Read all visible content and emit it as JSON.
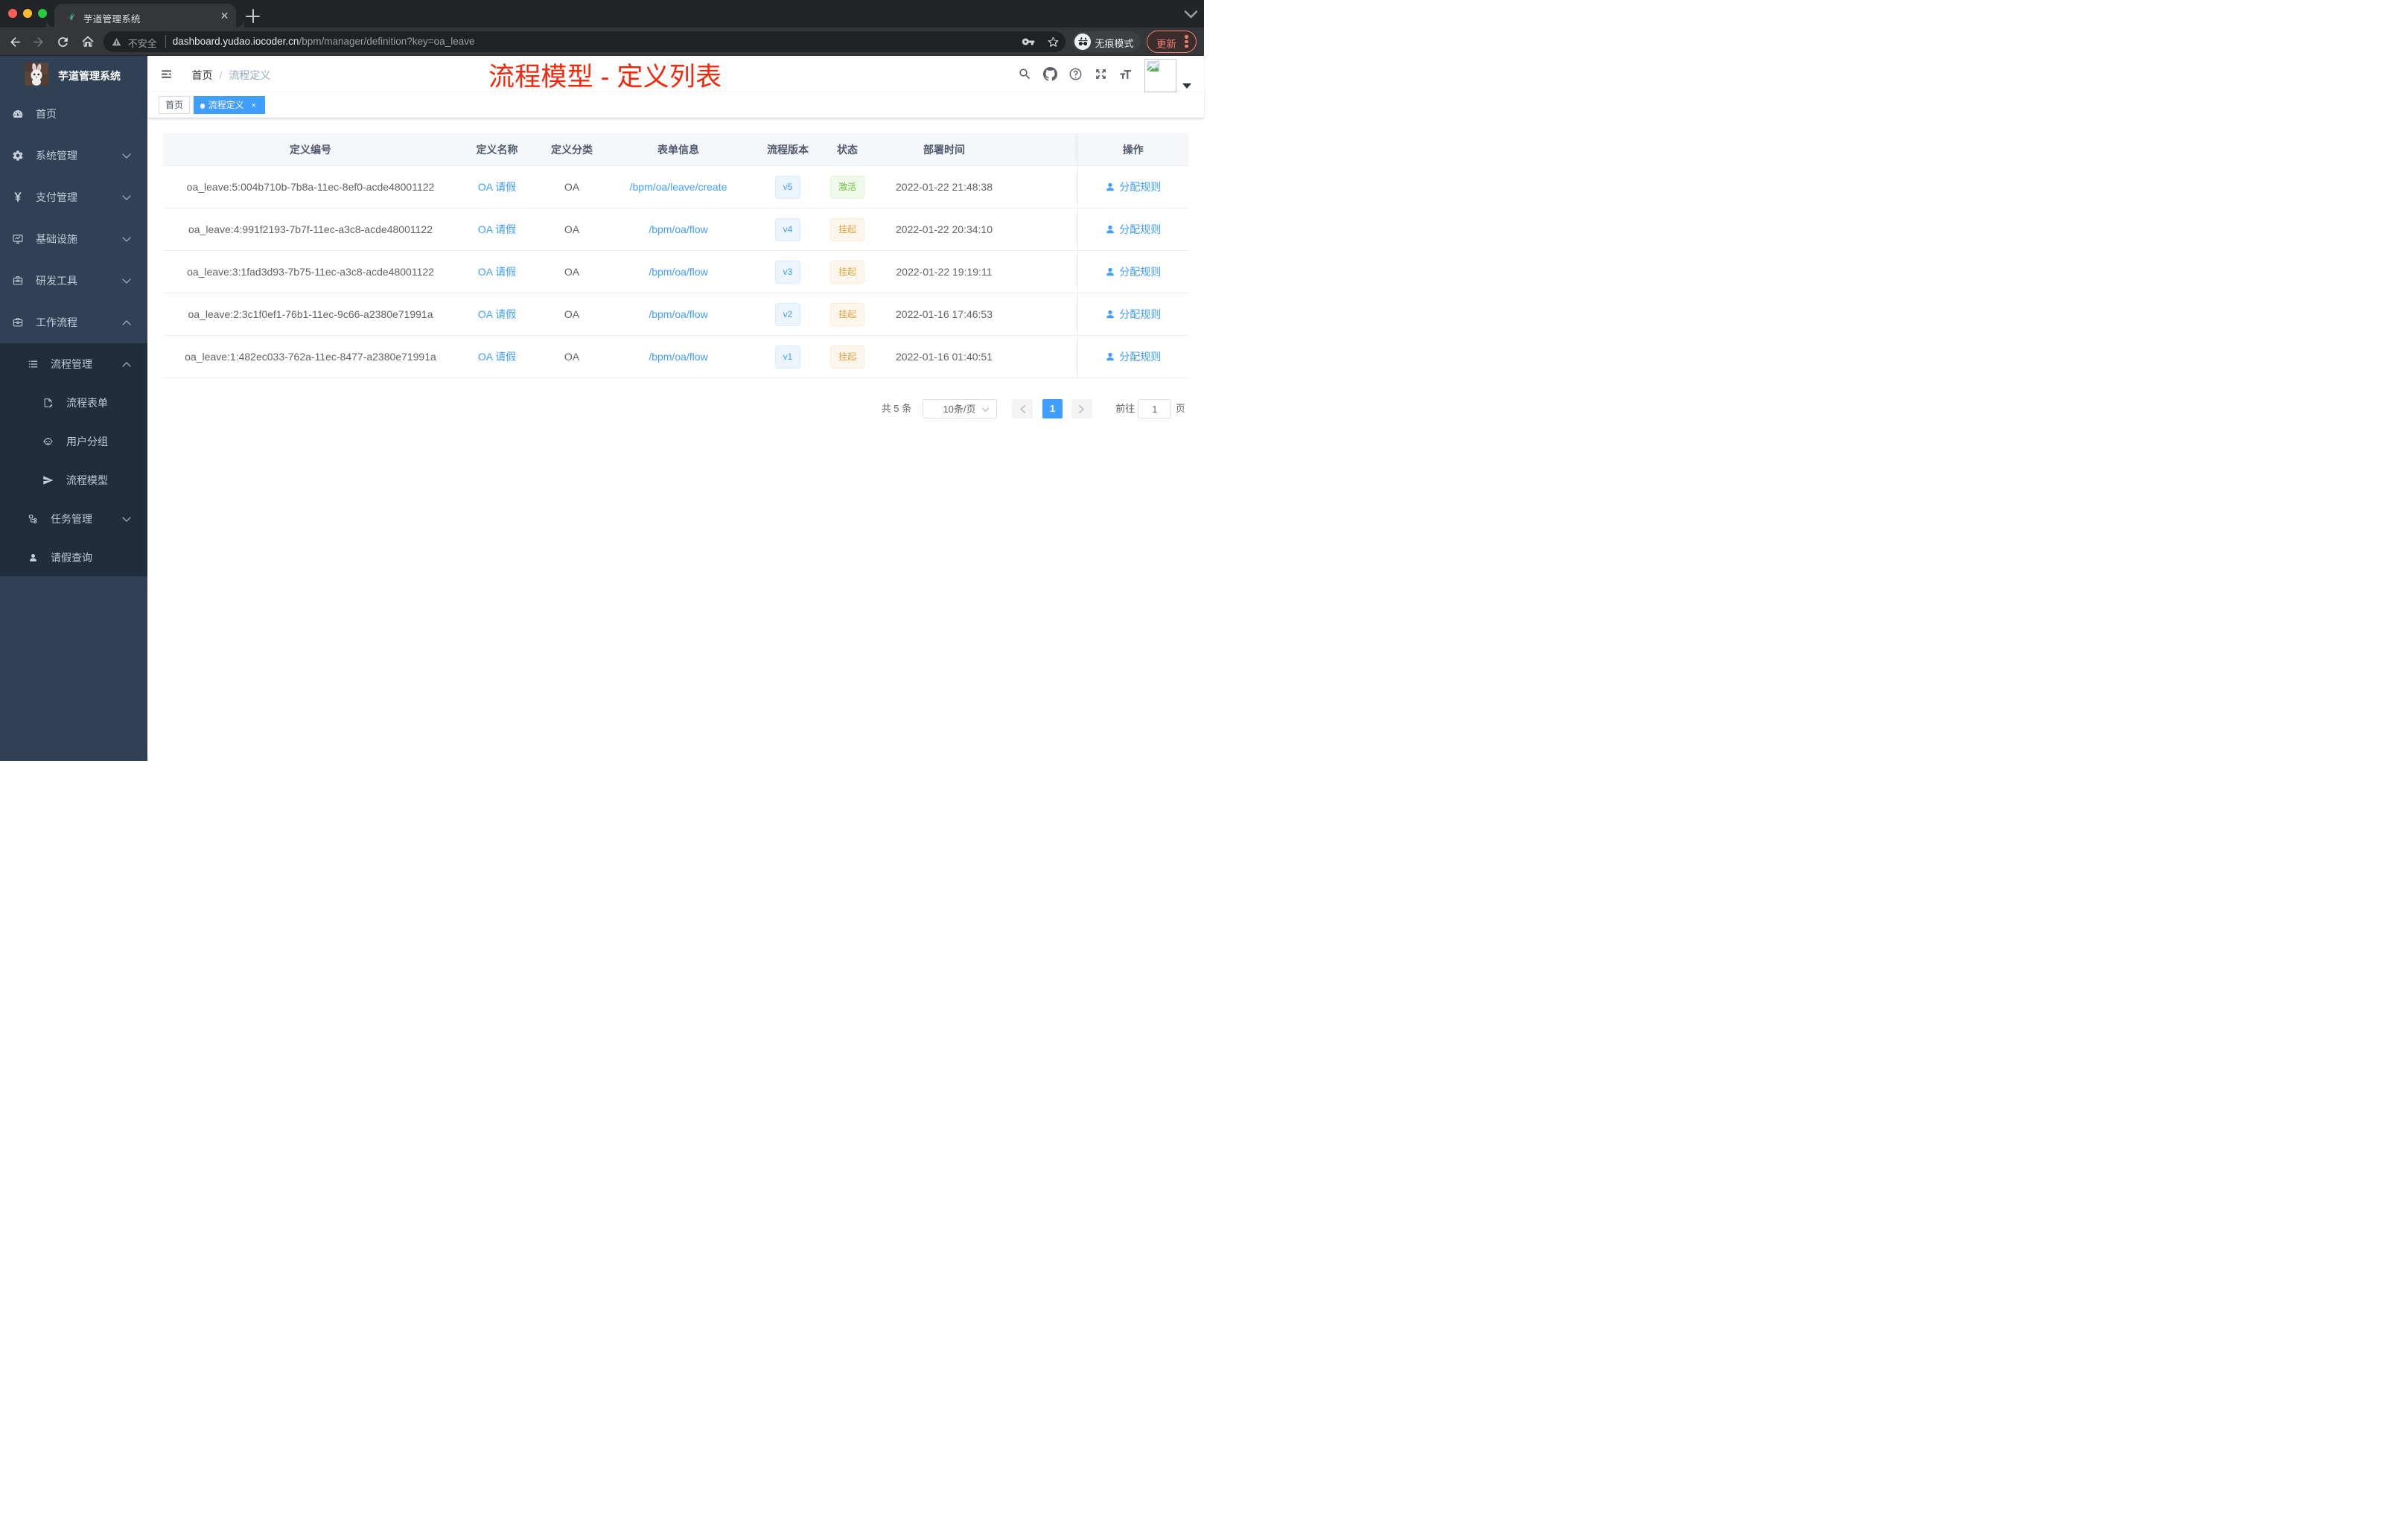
{
  "browser": {
    "tab_title": "芋道管理系统",
    "url_secure_label": "不安全",
    "url_domain": "dashboard.yudao.iocoder.cn",
    "url_path": "/bpm/manager/definition?key=oa_leave",
    "incognito_label": "无痕模式",
    "update_label": "更新"
  },
  "sidebar": {
    "title": "芋道管理系统",
    "items": [
      {
        "label": "首页",
        "icon": "dashboard-icon",
        "level": 0,
        "arrow": ""
      },
      {
        "label": "系统管理",
        "icon": "gear-icon",
        "level": 0,
        "arrow": "down"
      },
      {
        "label": "支付管理",
        "icon": "yen-icon",
        "level": 0,
        "arrow": "down"
      },
      {
        "label": "基础设施",
        "icon": "monitor-icon",
        "level": 0,
        "arrow": "down"
      },
      {
        "label": "研发工具",
        "icon": "briefcase-icon",
        "level": 0,
        "arrow": "down"
      },
      {
        "label": "工作流程",
        "icon": "briefcase-icon",
        "level": 0,
        "arrow": "up"
      }
    ],
    "submenu_items": [
      {
        "label": "流程管理",
        "icon": "list-tree-icon",
        "level": 1,
        "arrow": "up"
      },
      {
        "label": "流程表单",
        "icon": "doc-edit-icon",
        "level": 2,
        "arrow": ""
      },
      {
        "label": "用户分组",
        "icon": "robot-icon",
        "level": 2,
        "arrow": ""
      },
      {
        "label": "流程模型",
        "icon": "send-icon",
        "level": 2,
        "arrow": ""
      },
      {
        "label": "任务管理",
        "icon": "flow-icon",
        "level": 1,
        "arrow": "down"
      },
      {
        "label": "请假查询",
        "icon": "user-icon",
        "level": 1,
        "arrow": ""
      }
    ]
  },
  "navbar": {
    "breadcrumb": {
      "home": "首页",
      "current": "流程定义"
    }
  },
  "tags": [
    {
      "label": "首页",
      "active": false
    },
    {
      "label": "流程定义",
      "active": true
    }
  ],
  "annotation": "流程模型 - 定义列表",
  "table": {
    "headers": [
      "定义编号",
      "定义名称",
      "定义分类",
      "表单信息",
      "流程版本",
      "状态",
      "部署时间",
      "操作"
    ],
    "action_label": "分配规则",
    "rows": [
      {
        "id": "oa_leave:5:004b710b-7b8a-11ec-8ef0-acde48001122",
        "name": "OA 请假",
        "category": "OA",
        "form": "/bpm/oa/leave/create",
        "version": "v5",
        "status": "激活",
        "status_type": "active",
        "time": "2022-01-22 21:48:38"
      },
      {
        "id": "oa_leave:4:991f2193-7b7f-11ec-a3c8-acde48001122",
        "name": "OA 请假",
        "category": "OA",
        "form": "/bpm/oa/flow",
        "version": "v4",
        "status": "挂起",
        "status_type": "suspended",
        "time": "2022-01-22 20:34:10"
      },
      {
        "id": "oa_leave:3:1fad3d93-7b75-11ec-a3c8-acde48001122",
        "name": "OA 请假",
        "category": "OA",
        "form": "/bpm/oa/flow",
        "version": "v3",
        "status": "挂起",
        "status_type": "suspended",
        "time": "2022-01-22 19:19:11"
      },
      {
        "id": "oa_leave:2:3c1f0ef1-76b1-11ec-9c66-a2380e71991a",
        "name": "OA 请假",
        "category": "OA",
        "form": "/bpm/oa/flow",
        "version": "v2",
        "status": "挂起",
        "status_type": "suspended",
        "time": "2022-01-16 17:46:53"
      },
      {
        "id": "oa_leave:1:482ec033-762a-11ec-8477-a2380e71991a",
        "name": "OA 请假",
        "category": "OA",
        "form": "/bpm/oa/flow",
        "version": "v1",
        "status": "挂起",
        "status_type": "suspended",
        "time": "2022-01-16 01:40:51"
      }
    ]
  },
  "pagination": {
    "total_label": "共 5 条",
    "page_size_label": "10条/页",
    "current_page": "1",
    "goto_label": "前往",
    "goto_value": "1",
    "unit_label": "页"
  },
  "colors": {
    "primary": "#409EFF",
    "success": "#67C23A",
    "warning": "#E6A23C",
    "annotation_red": "#F5270B",
    "sidebar_bg": "#304156",
    "sidebar_sub_bg": "#1F2D3D",
    "update_salmon": "#EE7E72"
  }
}
